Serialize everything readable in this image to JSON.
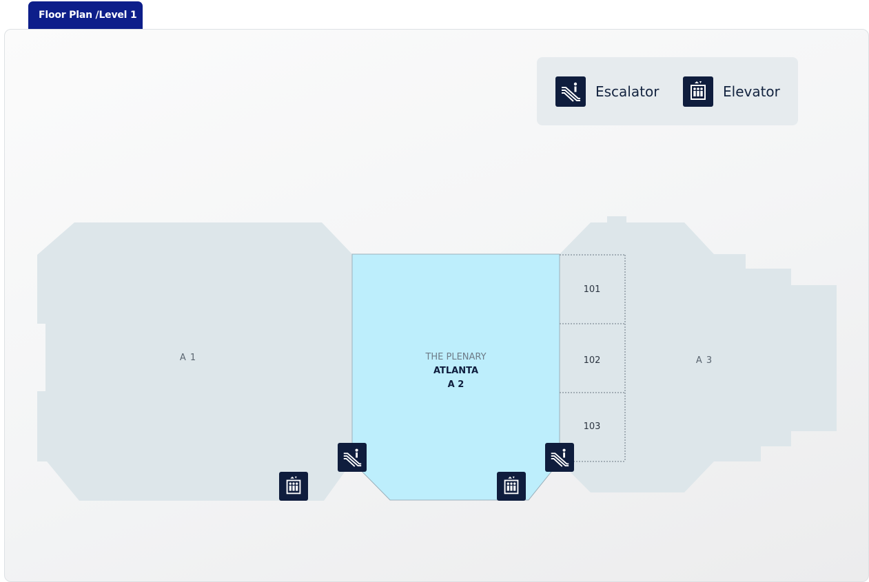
{
  "header": {
    "tab_label": "Floor Plan /Level 1"
  },
  "legend": {
    "escalator": {
      "icon": "escalator-icon",
      "label": "Escalator"
    },
    "elevator": {
      "icon": "elevator-icon",
      "label": "Elevator"
    }
  },
  "map": {
    "halls": {
      "a1": {
        "label": "A 1"
      },
      "a2": {
        "sub_label": "THE PLENARY",
        "name": "ATLANTA",
        "code": "A 2"
      },
      "a3": {
        "label": "A 3"
      }
    },
    "rooms": [
      {
        "label": "101"
      },
      {
        "label": "102"
      },
      {
        "label": "103"
      }
    ]
  },
  "colors": {
    "tab": "#0d1e8a",
    "hall_fill": "#dde6ea",
    "plenary_fill": "#bdeefc",
    "icon_bg": "#0f1d3d",
    "legend_bg": "#e6ebee"
  }
}
